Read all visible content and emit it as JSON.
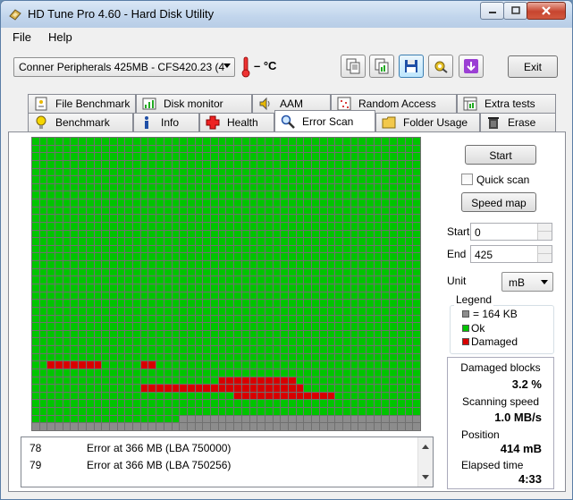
{
  "window": {
    "title": "HD Tune Pro 4.60 - Hard Disk Utility"
  },
  "menu": {
    "file": "File",
    "help": "Help"
  },
  "toolbar": {
    "drive": "Conner Peripherals 425MB - CFS420.23 (4",
    "temperature": "– °C",
    "exit_label": "Exit",
    "icons": [
      "copy-text-icon",
      "copy-screenshot-icon",
      "save-icon",
      "settings-icon",
      "options-icon"
    ]
  },
  "tabs_top": [
    "File Benchmark",
    "Disk monitor",
    "AAM",
    "Random Access",
    "Extra tests"
  ],
  "tabs_bottom": [
    "Benchmark",
    "Info",
    "Health",
    "Error Scan",
    "Folder Usage",
    "Erase"
  ],
  "active_tab": "Error Scan",
  "colors": {
    "ok": "#00c400",
    "damaged": "#d80000",
    "empty": "#8c8c8c",
    "grid_line": "#707070"
  },
  "scan": {
    "grid_cols": 50,
    "grid_rows": 38,
    "damaged_segments": [
      {
        "row": 29,
        "from": 2,
        "to": 8
      },
      {
        "row": 29,
        "from": 14,
        "to": 15
      },
      {
        "row": 31,
        "from": 24,
        "to": 33
      },
      {
        "row": 32,
        "from": 14,
        "to": 34
      },
      {
        "row": 33,
        "from": 26,
        "to": 38
      }
    ],
    "unscanned_start": {
      "row": 36,
      "col": 19
    }
  },
  "log": [
    {
      "n": "78",
      "msg": "Error at 366 MB (LBA 750000)"
    },
    {
      "n": "79",
      "msg": "Error at 366 MB (LBA 750256)"
    }
  ],
  "controls": {
    "start_label": "Start",
    "quick_scan_label": "Quick scan",
    "quick_scan_checked": false,
    "speed_map_label": "Speed map",
    "start_field_label": "Start",
    "start_value": "0",
    "end_field_label": "End",
    "end_value": "425",
    "unit_label": "Unit",
    "unit_value": "mB"
  },
  "legend": {
    "title": "Legend",
    "block": "= 164 KB",
    "ok": "Ok",
    "damaged": "Damaged"
  },
  "stats": {
    "damaged_label": "Damaged blocks",
    "damaged_value": "3.2 %",
    "speed_label": "Scanning speed",
    "speed_value": "1.0 MB/s",
    "position_label": "Position",
    "position_value": "414 mB",
    "elapsed_label": "Elapsed time",
    "elapsed_value": "4:33"
  }
}
